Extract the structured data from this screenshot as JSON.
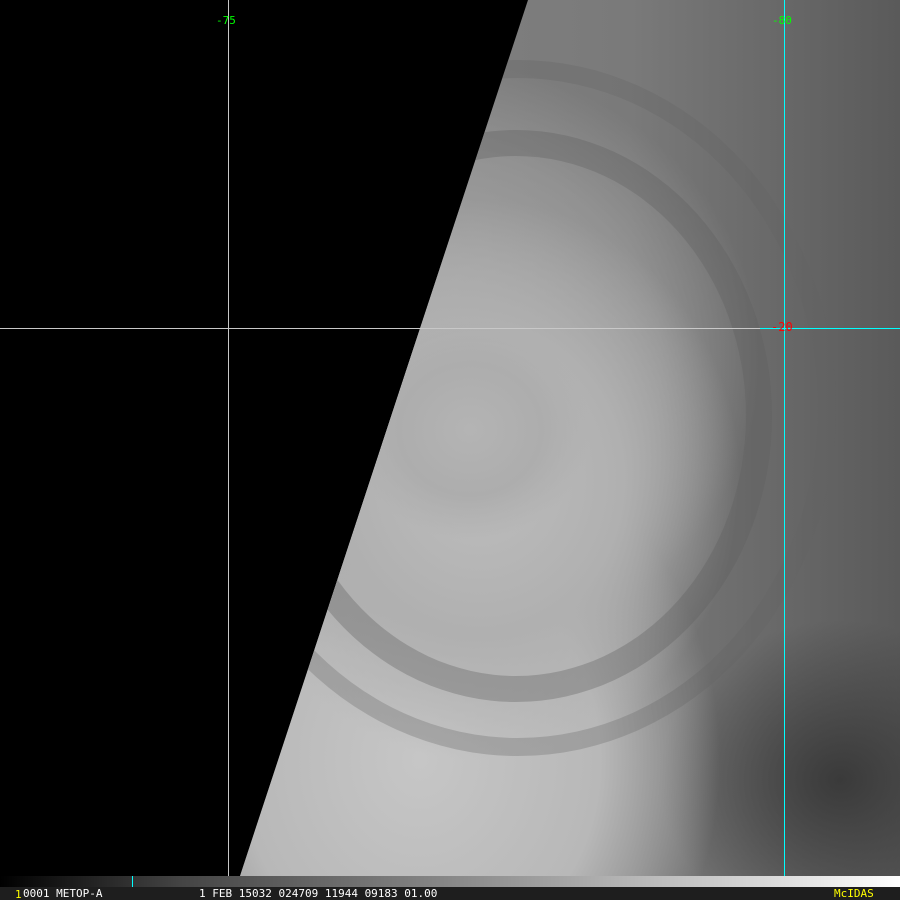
{
  "grid": {
    "lon_labels": [
      "-75",
      "-80"
    ],
    "lat_labels": [
      "-20"
    ],
    "colors": {
      "lon_label": "#00ff00",
      "lat_label": "#ff0000",
      "grid_gray": "#c8c8c8",
      "grid_cyan": "#00ffff"
    }
  },
  "footer": {
    "frame_index": "1",
    "info": "0001 METOP-A",
    "datetime": "1 FEB 15032 024709 11944 09183 01.00",
    "brand": "McIDAS",
    "brand_color": "#ffff00"
  }
}
